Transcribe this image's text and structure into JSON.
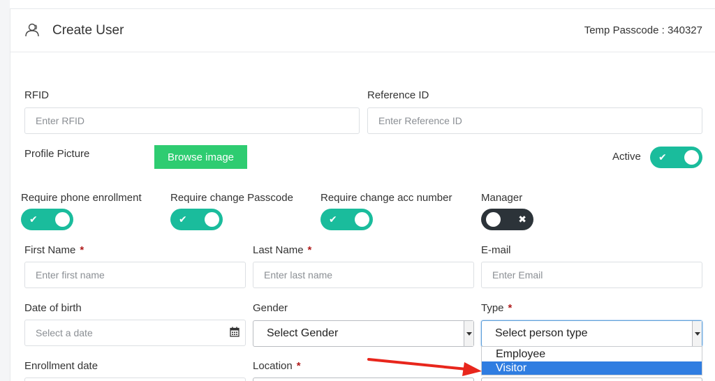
{
  "header": {
    "title": "Create User",
    "temp_passcode": "Temp Passcode : 340327"
  },
  "fields": {
    "rfid": {
      "label": "RFID",
      "placeholder": "Enter RFID"
    },
    "reference_id": {
      "label": "Reference ID",
      "placeholder": "Enter Reference ID"
    },
    "profile_picture": {
      "label": "Profile Picture",
      "button": "Browse image"
    },
    "active": {
      "label": "Active",
      "on": true
    },
    "first_name": {
      "label": "First Name",
      "required": "*",
      "placeholder": "Enter first name"
    },
    "last_name": {
      "label": "Last Name",
      "required": "*",
      "placeholder": "Enter last name"
    },
    "email": {
      "label": "E-mail",
      "placeholder": "Enter Email"
    },
    "dob": {
      "label": "Date of birth",
      "placeholder": "Select a date"
    },
    "gender": {
      "label": "Gender",
      "selected": "Select Gender"
    },
    "type": {
      "label": "Type",
      "required": "*",
      "selected": "Select person type",
      "options": [
        "Employee",
        "Visitor"
      ],
      "highlighted": "Visitor"
    },
    "enrollment_date": {
      "label": "Enrollment date"
    },
    "location": {
      "label": "Location",
      "required": "*"
    }
  },
  "toggles": [
    {
      "label": "Require phone enrollment",
      "on": true
    },
    {
      "label": "Require change Passcode",
      "on": true
    },
    {
      "label": "Require change acc number",
      "on": true
    },
    {
      "label": "Manager",
      "on": false
    }
  ],
  "glyphs": {
    "check": "✔",
    "cross": "✖"
  },
  "colors": {
    "toggle_on": "#1abc9c",
    "toggle_off": "#2c3339",
    "browse_button": "#2ecc71",
    "annotation_arrow": "#e8261c",
    "dropdown_highlight": "#2f7de1",
    "required_mark": "#b01b1b"
  }
}
